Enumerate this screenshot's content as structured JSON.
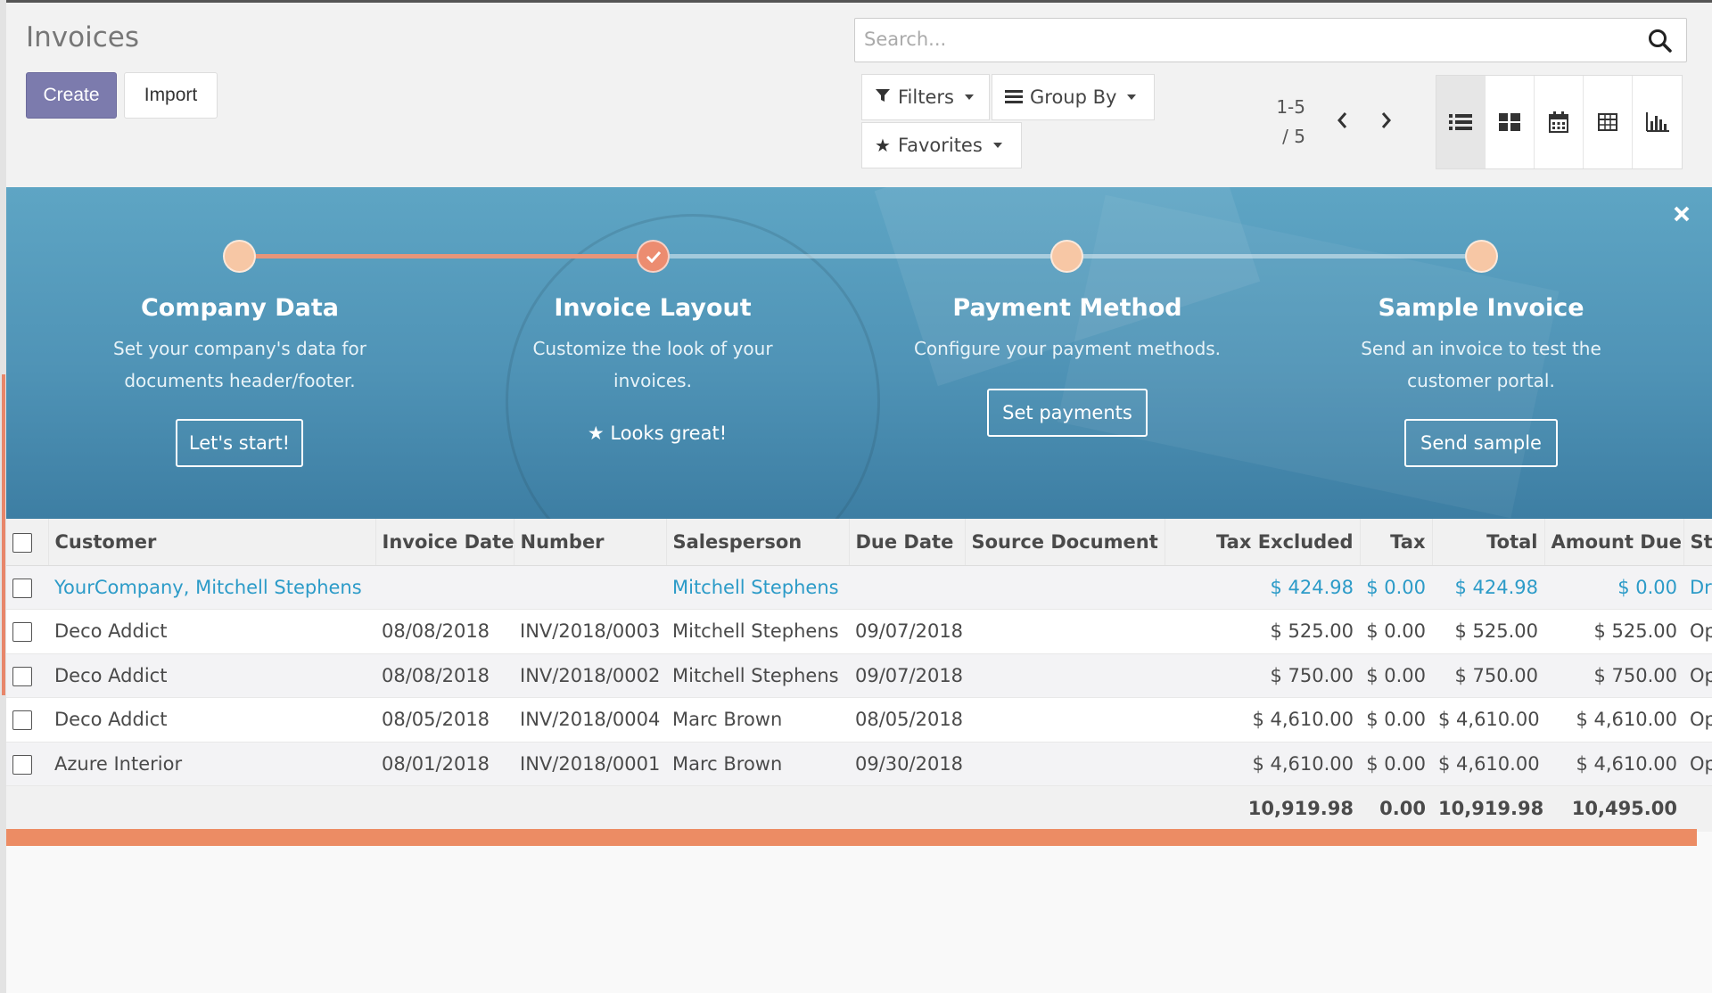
{
  "header": {
    "title": "Invoices",
    "create_label": "Create",
    "import_label": "Import"
  },
  "search": {
    "placeholder": "Search..."
  },
  "filters": {
    "filters_label": "Filters",
    "groupby_label": "Group By",
    "favorites_label": "Favorites"
  },
  "pager": {
    "range": "1-5",
    "total": "/ 5"
  },
  "views": [
    "list-view-icon",
    "kanban-view-icon",
    "calendar-view-icon",
    "pivot-view-icon",
    "graph-view-icon"
  ],
  "onboarding": {
    "steps": [
      {
        "title": "Company Data",
        "desc_line1": "Set your company's data for",
        "desc_line2": "documents header/footer.",
        "button": "Let's start!"
      },
      {
        "title": "Invoice Layout",
        "desc_line1": "Customize the look of your",
        "desc_line2": "invoices.",
        "status": "Looks great!"
      },
      {
        "title": "Payment Method",
        "desc_line1": "Configure your payment methods.",
        "desc_line2": "",
        "button": "Set payments"
      },
      {
        "title": "Sample Invoice",
        "desc_line1": "Send an invoice to test the",
        "desc_line2": "customer portal.",
        "button": "Send sample"
      }
    ]
  },
  "table": {
    "columns": [
      "Customer",
      "Invoice Date",
      "Number",
      "Salesperson",
      "Due Date",
      "Source Document",
      "Tax Excluded",
      "Tax",
      "Total",
      "Amount Due",
      "Status"
    ],
    "rows": [
      {
        "customer": "YourCompany, Mitchell Stephens",
        "invoice_date": "",
        "number": "",
        "salesperson": "Mitchell Stephens",
        "due_date": "",
        "source": "",
        "tax_excluded": "$ 424.98",
        "tax": "$ 0.00",
        "total": "$ 424.98",
        "amount_due": "$ 0.00",
        "status": "Draft"
      },
      {
        "customer": "Deco Addict",
        "invoice_date": "08/08/2018",
        "number": "INV/2018/0003",
        "salesperson": "Mitchell Stephens",
        "due_date": "09/07/2018",
        "source": "",
        "tax_excluded": "$ 525.00",
        "tax": "$ 0.00",
        "total": "$ 525.00",
        "amount_due": "$ 525.00",
        "status": "Open"
      },
      {
        "customer": "Deco Addict",
        "invoice_date": "08/08/2018",
        "number": "INV/2018/0002",
        "salesperson": "Mitchell Stephens",
        "due_date": "09/07/2018",
        "source": "",
        "tax_excluded": "$ 750.00",
        "tax": "$ 0.00",
        "total": "$ 750.00",
        "amount_due": "$ 750.00",
        "status": "Open"
      },
      {
        "customer": "Deco Addict",
        "invoice_date": "08/05/2018",
        "number": "INV/2018/0004",
        "salesperson": "Marc Brown",
        "due_date": "08/05/2018",
        "source": "",
        "tax_excluded": "$ 4,610.00",
        "tax": "$ 0.00",
        "total": "$ 4,610.00",
        "amount_due": "$ 4,610.00",
        "status": "Open"
      },
      {
        "customer": "Azure Interior",
        "invoice_date": "08/01/2018",
        "number": "INV/2018/0001",
        "salesperson": "Marc Brown",
        "due_date": "09/30/2018",
        "source": "",
        "tax_excluded": "$ 4,610.00",
        "tax": "$ 0.00",
        "total": "$ 4,610.00",
        "amount_due": "$ 4,610.00",
        "status": "Open"
      }
    ],
    "totals": {
      "tax_excluded": "10,919.98",
      "tax": "0.00",
      "total": "10,919.98",
      "amount_due": "10,495.00"
    }
  },
  "colors": {
    "primary": "#7c7bad",
    "banner": "#4f93b6",
    "accent": "#ec8c64",
    "link": "#2c9bc8"
  }
}
